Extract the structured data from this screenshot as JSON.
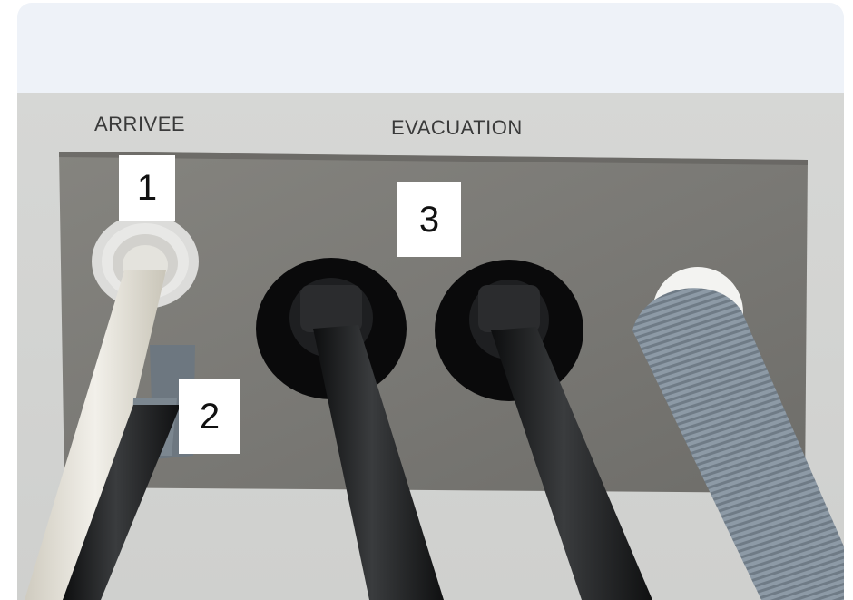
{
  "photo": {
    "wall_labels": {
      "arrivee": "ARRIVEE",
      "evacuation": "EVACUATION"
    },
    "markers": [
      "1",
      "2",
      "3"
    ],
    "colors": {
      "header": "#eef2f8",
      "wall": "#d8d8d6",
      "panel": "#7c7b78",
      "white_hose": "#e6e4dc",
      "black_hose": "#1c1d1e",
      "gray_hose": "#8a97a3"
    }
  }
}
